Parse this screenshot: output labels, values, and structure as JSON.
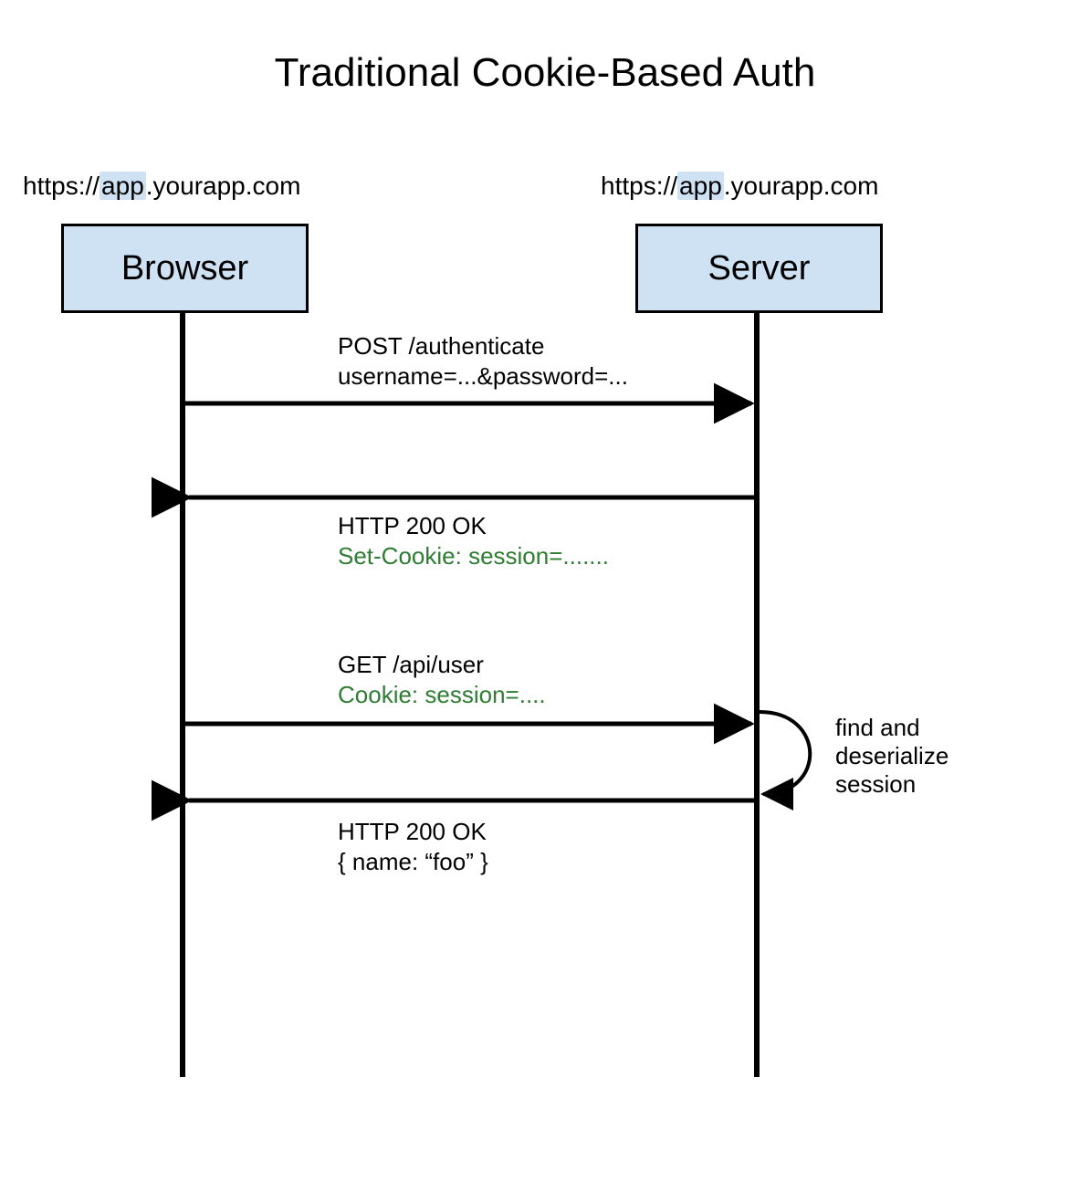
{
  "title": "Traditional Cookie-Based Auth",
  "actors": {
    "left": {
      "url_prefix": "https://",
      "url_highlight": "app",
      "url_suffix": ".yourapp.com",
      "label": "Browser"
    },
    "right": {
      "url_prefix": "https://",
      "url_highlight": "app",
      "url_suffix": ".yourapp.com",
      "label": "Server"
    }
  },
  "messages": {
    "m1_line1": "POST /authenticate",
    "m1_line2": "username=...&password=...",
    "m2_line1": "HTTP 200 OK",
    "m2_line2": "Set-Cookie: session=.......",
    "m3_line1": "GET /api/user",
    "m3_line2": "Cookie: session=....",
    "m4_line1": "HTTP 200 OK",
    "m4_line2": "{  name: “foo” }"
  },
  "self_note": {
    "line1": "find and",
    "line2": "deserialize",
    "line3": "session"
  }
}
